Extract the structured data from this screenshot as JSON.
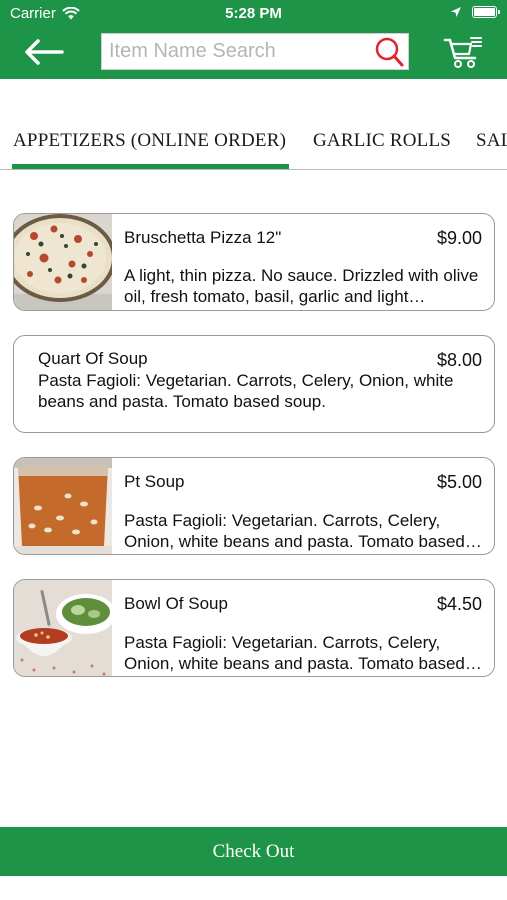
{
  "status_bar": {
    "carrier": "Carrier",
    "time": "5:28 PM",
    "battery_level": 1.0
  },
  "header": {
    "background_color": "#1e9449",
    "back_icon": "arrow-left-icon",
    "search": {
      "placeholder": "Item Name Search",
      "value": "",
      "icon": "search-icon",
      "icon_color": "#e0262b"
    },
    "cart_icon": "shopping-cart-icon"
  },
  "tabs": {
    "items": [
      {
        "label": "APPETIZERS (ONLINE ORDER)",
        "selected": true
      },
      {
        "label": "GARLIC ROLLS",
        "selected": false
      },
      {
        "label": "SAL",
        "selected": false
      }
    ],
    "accent_color": "#1e9449"
  },
  "menu": {
    "items": [
      {
        "name": "Bruschetta Pizza 12\"",
        "price": "$9.00",
        "description": "A light, thin pizza. No sauce. Drizzled with olive oil, fresh tomato, basil, garlic and light mozzarella.",
        "has_photo": true,
        "photo": "pizza-photo"
      },
      {
        "name": "Quart Of Soup",
        "price": "$8.00",
        "description": "Pasta Fagioli: Vegetarian. Carrots, Celery, Onion, white beans and pasta. Tomato based soup.",
        "has_photo": false
      },
      {
        "name": "Pt Soup",
        "price": "$5.00",
        "description": "Pasta Fagioli: Vegetarian. Carrots, Celery, Onion, white beans and pasta. Tomato based soup.",
        "has_photo": true,
        "photo": "soup-container-photo"
      },
      {
        "name": "Bowl Of Soup",
        "price": "$4.50",
        "description": "Pasta Fagioli: Vegetarian. Carrots, Celery, Onion, white beans and pasta. Tomato based soup.",
        "has_photo": true,
        "photo": "soup-bowl-salad-photo"
      }
    ]
  },
  "checkout": {
    "label": "Check Out"
  }
}
